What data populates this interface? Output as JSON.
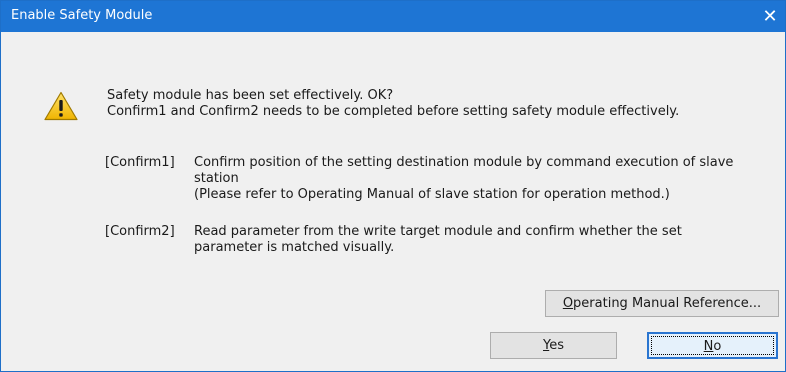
{
  "dialog": {
    "title": "Enable Safety Module",
    "close_glyph": "✕",
    "icon": "warning-icon"
  },
  "message": {
    "line1": "Safety module has been set effectively. OK?",
    "line2": "Confirm1 and Confirm2 needs to be completed before setting safety module effectively."
  },
  "confirm1": {
    "tag": "[Confirm1]",
    "lines": [
      "Confirm position of the setting destination module by command execution of slave",
      "station",
      "(Please refer to Operating Manual of slave station for operation method.)"
    ]
  },
  "confirm2": {
    "tag": "[Confirm2]",
    "lines": [
      "Read parameter from the write target module and confirm whether the set",
      "parameter is matched visually."
    ]
  },
  "buttons": {
    "manual": {
      "mnemonic": "O",
      "rest": "perating Manual Reference..."
    },
    "yes": {
      "mnemonic": "Y",
      "rest": "es"
    },
    "no": {
      "mnemonic": "N",
      "rest": "o"
    }
  },
  "colors": {
    "titlebar": "#1e75d4",
    "warning_fill": "#f5c518",
    "default_button_border": "#2a75d0"
  }
}
